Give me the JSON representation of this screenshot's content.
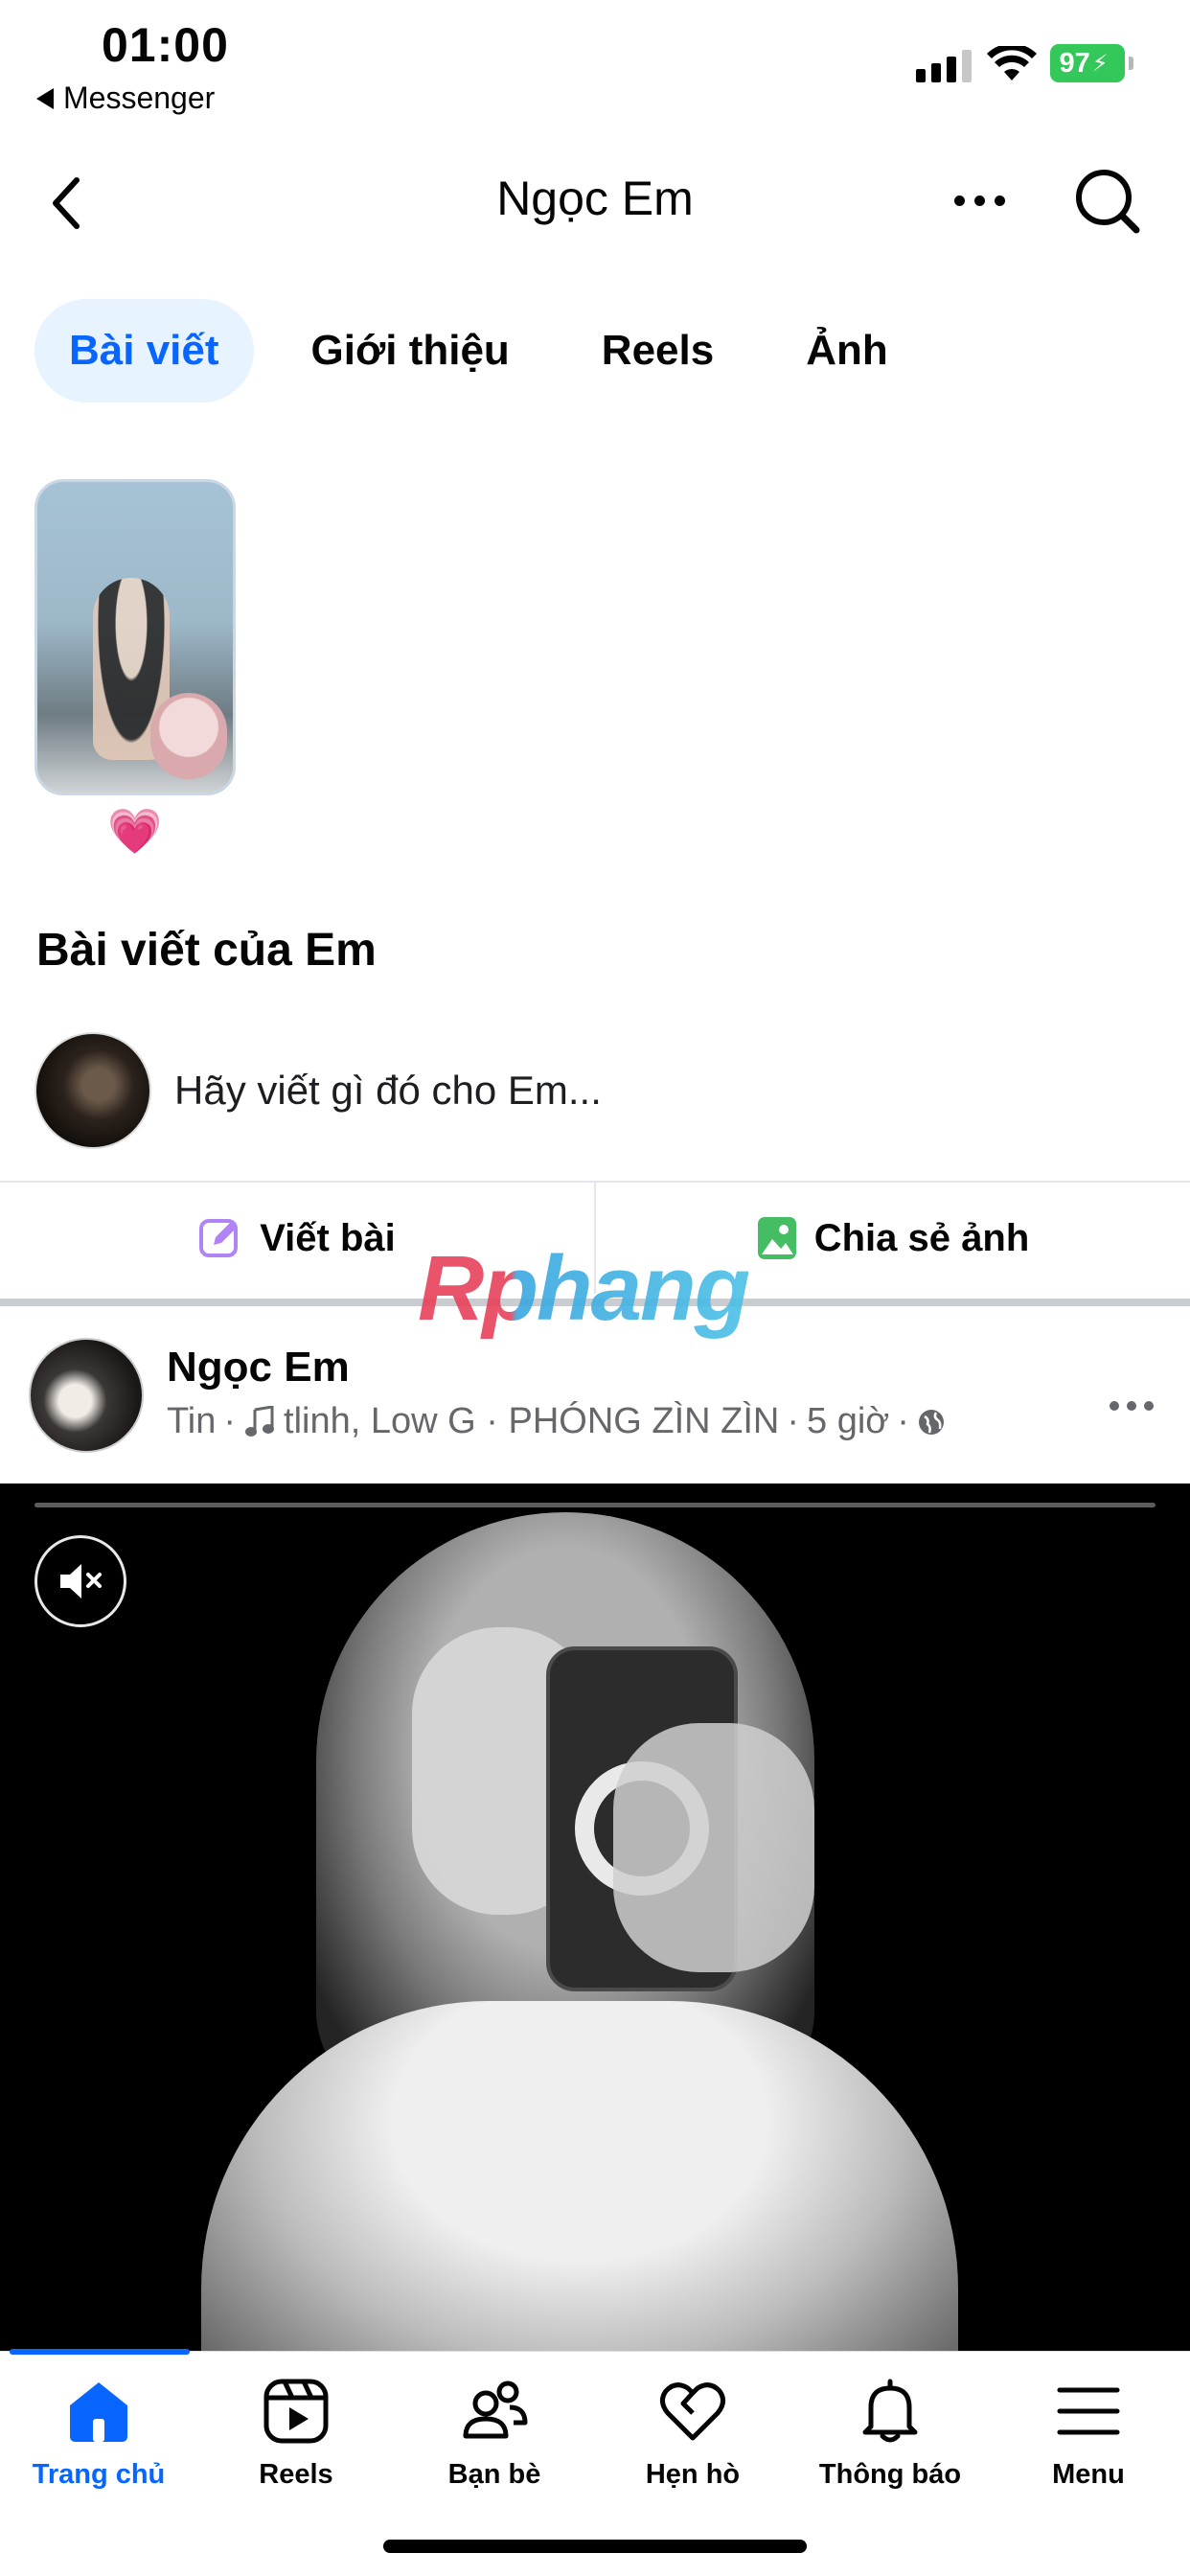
{
  "status_bar": {
    "time": "01:00",
    "back_app": "Messenger",
    "battery": "97"
  },
  "header": {
    "title": "Ngọc Em"
  },
  "tabs": [
    {
      "label": "Bài viết",
      "active": true
    },
    {
      "label": "Giới thiệu",
      "active": false
    },
    {
      "label": "Reels",
      "active": false
    },
    {
      "label": "Ảnh",
      "active": false
    }
  ],
  "highlight": {
    "caption_emoji": "💗"
  },
  "posts_section": {
    "title": "Bài viết của Em",
    "composer_placeholder": "Hãy viết gì đó cho Em...",
    "write_post_label": "Viết bài",
    "share_photo_label": "Chia sẻ ảnh"
  },
  "watermark": "Rphang",
  "post": {
    "author": "Ngọc Em",
    "meta_type": "Tin",
    "meta_music": "tlinh, Low G · PHÓNG ZÌN ZÌN",
    "meta_time": "5 giờ"
  },
  "bottom_nav": [
    {
      "label": "Trang chủ",
      "icon": "home-icon",
      "active": true
    },
    {
      "label": "Reels",
      "icon": "reels-icon",
      "active": false
    },
    {
      "label": "Bạn bè",
      "icon": "friends-icon",
      "active": false
    },
    {
      "label": "Hẹn hò",
      "icon": "dating-heart-icon",
      "active": false
    },
    {
      "label": "Thông báo",
      "icon": "bell-icon",
      "active": false
    },
    {
      "label": "Menu",
      "icon": "menu-icon",
      "active": false
    }
  ],
  "colors": {
    "accent": "#0866ff",
    "tab_active_bg": "#e7f3ff",
    "battery": "#34c759",
    "heart": "#f0359b",
    "secondary_text": "#65676b"
  }
}
